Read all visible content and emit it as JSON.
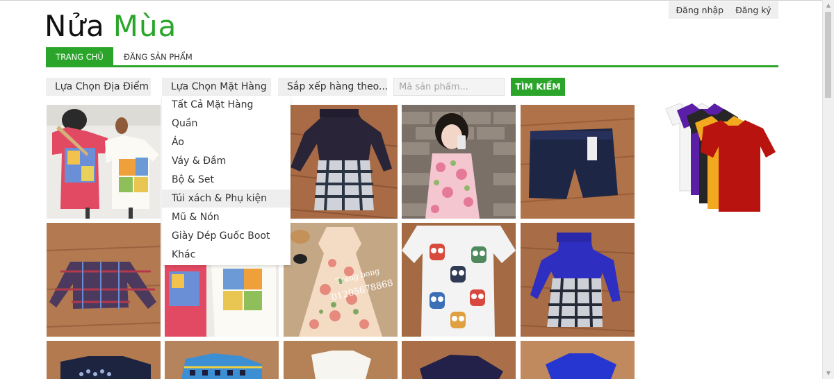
{
  "logo": {
    "word1": "Nửa",
    "word2": "Mùa"
  },
  "auth": {
    "login": "Đăng nhập",
    "register": "Đăng ký"
  },
  "nav": {
    "home": "TRANG CHỦ",
    "post": "ĐĂNG SẢN PHẨM"
  },
  "filters": {
    "location": "Lựa Chọn Địa Điểm",
    "category": "Lựa Chọn Mặt Hàng",
    "sort": "Sắp xếp hàng theo...",
    "code_placeholder": "Mã sản phẩm...",
    "search": "TÌM KIẾM"
  },
  "dropdown": {
    "highlighted": "Túi xách & Phụ kiện",
    "options": [
      "Tất Cả Mặt Hàng",
      "Quần",
      "Áo",
      "Váy & Đầm",
      "Bộ & Set",
      "Túi xách & Phụ kiện",
      "Mũ & Nón",
      "Giày Dép Guốc Boot",
      "Khác"
    ]
  },
  "photo_text": {
    "watermark_line1": "Trang bong",
    "watermark_line2": "01205678868"
  },
  "colors": {
    "accent": "#2aa52a",
    "bar_bg": "#efefef"
  },
  "icons": {
    "scroll_up": "arrow-up-icon",
    "scroll_down": "arrow-down-icon"
  }
}
